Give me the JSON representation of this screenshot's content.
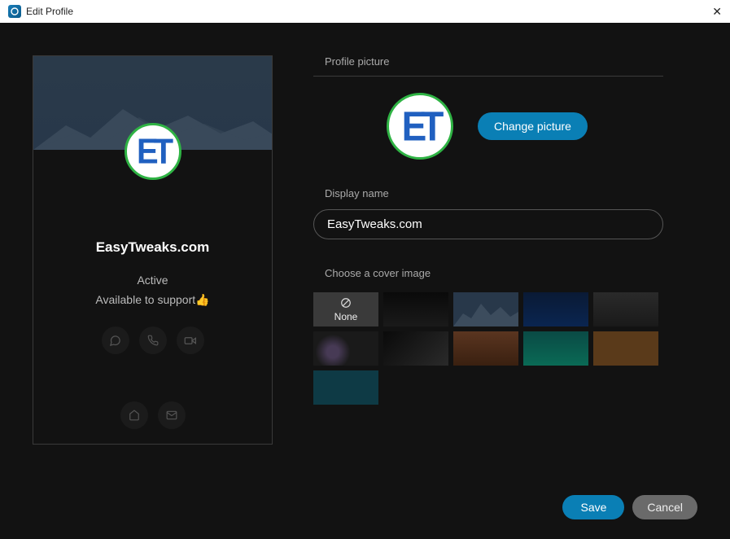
{
  "window": {
    "title": "Edit Profile"
  },
  "preview": {
    "display_name": "EasyTweaks.com",
    "status": "Active",
    "bio": "Available to support👍",
    "avatar_text": "ET"
  },
  "form": {
    "profile_picture_label": "Profile picture",
    "change_picture_label": "Change picture",
    "display_name_label": "Display name",
    "display_name_value": "EasyTweaks.com",
    "cover_label": "Choose a cover image",
    "cover_none_label": "None",
    "avatar_text": "ET"
  },
  "covers": [
    {
      "name": "none",
      "bg": "#3a3a3a",
      "is_none": true
    },
    {
      "name": "dark-gray",
      "bg": "linear-gradient(#0a0a0a,#1a1a1a)"
    },
    {
      "name": "mountain-blue",
      "bg": "linear-gradient(#2a3a4a,#28384a)"
    },
    {
      "name": "deep-blue",
      "bg": "linear-gradient(#0a1a35,#0a2550)"
    },
    {
      "name": "gray-shape",
      "bg": "linear-gradient(#2a2a2a,#1a1a1a)"
    },
    {
      "name": "dark-shape",
      "bg": "radial-gradient(circle at 30% 60%, #473a55 12%, #1a1a1a 35%)"
    },
    {
      "name": "black-curve",
      "bg": "linear-gradient(135deg,#0a0a0a,#2a2a2a)"
    },
    {
      "name": "desert",
      "bg": "linear-gradient(#5a3520,#3a2010)"
    },
    {
      "name": "aurora-teal",
      "bg": "linear-gradient(#0a4a45,#0a6a55)"
    },
    {
      "name": "brown",
      "bg": "#5a3a1a"
    },
    {
      "name": "teal-solid",
      "bg": "#0e3a45"
    }
  ],
  "footer": {
    "save_label": "Save",
    "cancel_label": "Cancel"
  }
}
